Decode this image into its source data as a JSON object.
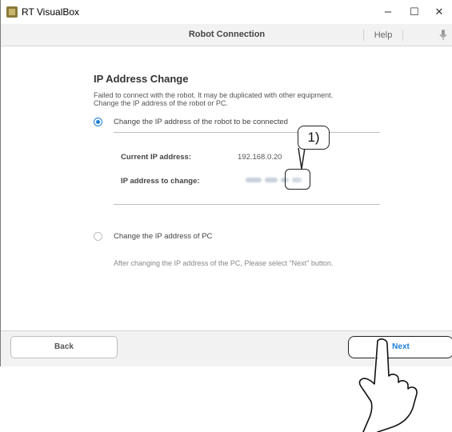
{
  "window": {
    "title": "RT VisualBox",
    "minimize": "–",
    "maximize": "☐",
    "close": "✕"
  },
  "toolbar": {
    "title": "Robot Connection",
    "help": "Help"
  },
  "page": {
    "heading": "IP Address Change",
    "description_line1": "Failed to connect with the robot. It may be duplicated with other equipment.",
    "description_line2": "Change the IP address of the robot or PC.",
    "option_robot": {
      "label": "Change the IP address of the robot to be connected",
      "selected": true,
      "current_ip_label": "Current IP address:",
      "current_ip_value": "192.168.0.20",
      "change_ip_label": "IP address to change:"
    },
    "option_pc": {
      "label": "Change the IP address of PC",
      "selected": false,
      "note": "After changing the IP address of the PC, Please select \"Next\" button."
    }
  },
  "callout": {
    "number": "1)"
  },
  "footer": {
    "back_label": "Back",
    "next_label": "Next"
  },
  "colors": {
    "accent": "#1c7ed6",
    "toolbar_bg": "#f2f2f2"
  },
  "icons": [
    "app-icon",
    "mic-icon",
    "hand-pointer-icon"
  ]
}
